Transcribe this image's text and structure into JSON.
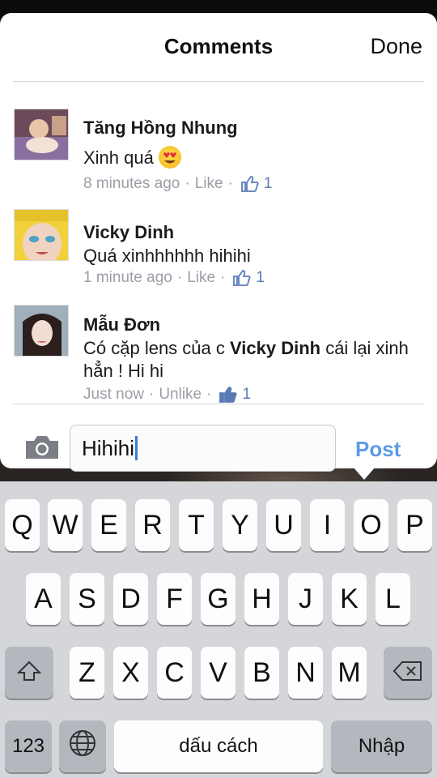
{
  "header": {
    "title": "Comments",
    "done_label": "Done"
  },
  "comments": [
    {
      "name": "Tăng Hồng Nhung",
      "text": "Xinh quá",
      "time": "8 minutes ago",
      "action": "Like",
      "likes": "1",
      "emoji": "heart-eyes-emoji"
    },
    {
      "name": "Vicky Dinh",
      "text": "Quá xinhhhhhh hihihi",
      "time": "1 minute ago",
      "action": "Like",
      "likes": "1"
    },
    {
      "name": "Mẫu Đơn",
      "text_before": "Có cặp lens của c ",
      "mention": "Vicky Dinh",
      "text_after": " cái lại xinh hẳn ! Hi hi",
      "time": "Just now",
      "action": "Unlike",
      "likes": "1"
    }
  ],
  "composer": {
    "value": "Hihihi",
    "post_label": "Post",
    "camera_icon": "camera-icon"
  },
  "keyboard": {
    "row1": [
      "Q",
      "W",
      "E",
      "R",
      "T",
      "Y",
      "U",
      "I",
      "O",
      "P"
    ],
    "row2": [
      "A",
      "S",
      "D",
      "F",
      "G",
      "H",
      "J",
      "K",
      "L"
    ],
    "row3": [
      "Z",
      "X",
      "C",
      "V",
      "B",
      "N",
      "M"
    ],
    "numbers_label": "123",
    "space_label": "dấu cách",
    "return_label": "Nhập"
  },
  "colors": {
    "link": "#5c9be8",
    "meta": "#9a9ea6",
    "like_count": "#5a7bb5",
    "caret": "#3b7be0"
  }
}
